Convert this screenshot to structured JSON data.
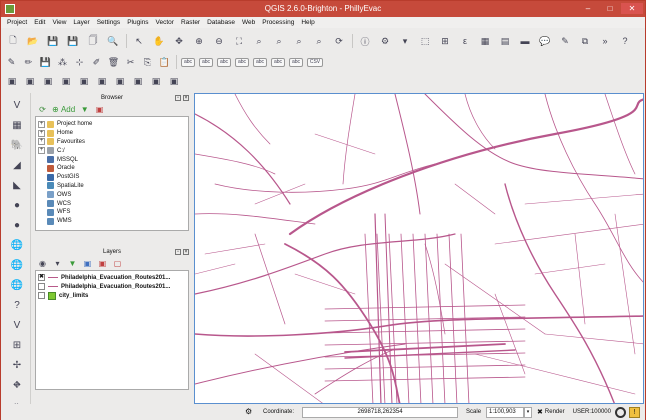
{
  "window": {
    "title": "QGIS 2.6.0-Brighton - PhillyEvac",
    "controls": {
      "minimize": "–",
      "maximize": "□",
      "close": "✕"
    }
  },
  "menu": [
    "Project",
    "Edit",
    "View",
    "Layer",
    "Settings",
    "Plugins",
    "Vector",
    "Raster",
    "Database",
    "Web",
    "Processing",
    "Help"
  ],
  "toolbars": {
    "row1": [
      {
        "name": "new-project-icon",
        "glyph": "🗋"
      },
      {
        "name": "open-project-icon",
        "glyph": "📂"
      },
      {
        "name": "save-project-icon",
        "glyph": "💾"
      },
      {
        "name": "save-as-icon",
        "glyph": "💾"
      },
      {
        "name": "new-print-composer-icon",
        "glyph": "🗍"
      },
      {
        "name": "composer-manager-icon",
        "glyph": "🔍"
      },
      {
        "name": "sep"
      },
      {
        "name": "select-pointer-icon",
        "glyph": "↖"
      },
      {
        "name": "pan-hand-icon",
        "glyph": "✋"
      },
      {
        "name": "pan-to-selection-icon",
        "glyph": "✥"
      },
      {
        "name": "zoom-in-icon",
        "glyph": "⊕"
      },
      {
        "name": "zoom-out-icon",
        "glyph": "⊖"
      },
      {
        "name": "zoom-full-icon",
        "glyph": "⛶"
      },
      {
        "name": "zoom-selection-icon",
        "glyph": "⌕"
      },
      {
        "name": "zoom-layer-icon",
        "glyph": "⌕"
      },
      {
        "name": "zoom-last-icon",
        "glyph": "⌕"
      },
      {
        "name": "zoom-next-icon",
        "glyph": "⌕"
      },
      {
        "name": "refresh-icon",
        "glyph": "⟳"
      },
      {
        "name": "sep"
      },
      {
        "name": "identify-icon",
        "glyph": "ⓘ"
      },
      {
        "name": "select-features-icon",
        "glyph": "⚙"
      },
      {
        "name": "select-dropdown-icon",
        "glyph": "▾"
      },
      {
        "name": "deselect-icon",
        "glyph": "⬚"
      },
      {
        "name": "field-calculator-icon",
        "glyph": "⊞"
      },
      {
        "name": "measure-icon",
        "glyph": "ε"
      },
      {
        "name": "attribute-table-icon",
        "glyph": "▦"
      },
      {
        "name": "statistics-icon",
        "glyph": "▤"
      },
      {
        "name": "measure-line-icon",
        "glyph": "▬"
      },
      {
        "name": "map-tips-icon",
        "glyph": "💬"
      },
      {
        "name": "new-bookmark-icon",
        "glyph": "✎"
      },
      {
        "name": "show-bookmarks-icon",
        "glyph": "⧉"
      },
      {
        "name": "text-annotation-icon",
        "glyph": "»"
      },
      {
        "name": "help-icon",
        "glyph": "?"
      }
    ],
    "row2": [
      {
        "name": "current-edits-icon",
        "glyph": "✎"
      },
      {
        "name": "toggle-editing-icon",
        "glyph": "✏"
      },
      {
        "name": "save-edits-icon",
        "glyph": "💾"
      },
      {
        "name": "add-feature-icon",
        "glyph": "⁂"
      },
      {
        "name": "move-feature-icon",
        "glyph": "⊹"
      },
      {
        "name": "node-tool-icon",
        "glyph": "✐"
      },
      {
        "name": "delete-selected-icon",
        "glyph": "🗑"
      },
      {
        "name": "cut-features-icon",
        "glyph": "✂"
      },
      {
        "name": "copy-features-icon",
        "glyph": "⎘"
      },
      {
        "name": "paste-features-icon",
        "glyph": "📋"
      },
      {
        "name": "sep"
      },
      {
        "name": "label-tool-icon",
        "glyph": "abc"
      },
      {
        "name": "highlight-pinned-icon",
        "glyph": "abc"
      },
      {
        "name": "pin-labels-icon",
        "glyph": "abc"
      },
      {
        "name": "show-hide-labels-icon",
        "glyph": "abc"
      },
      {
        "name": "move-label-icon",
        "glyph": "abc"
      },
      {
        "name": "rotate-label-icon",
        "glyph": "abc"
      },
      {
        "name": "change-label-icon",
        "glyph": "abc"
      },
      {
        "name": "csv-icon",
        "glyph": "CSV"
      }
    ],
    "row3": [
      {
        "name": "add-vector-layer-icon",
        "glyph": "▣"
      },
      {
        "name": "add-raster-layer-icon",
        "glyph": "▣"
      },
      {
        "name": "add-postgis-layer-icon",
        "glyph": "▣"
      },
      {
        "name": "add-spatialite-layer-icon",
        "glyph": "▣"
      },
      {
        "name": "add-mssql-layer-icon",
        "glyph": "▣"
      },
      {
        "name": "add-oracle-layer-icon",
        "glyph": "▣"
      },
      {
        "name": "add-wms-layer-icon",
        "glyph": "▣"
      },
      {
        "name": "add-wcs-layer-icon",
        "glyph": "▣"
      },
      {
        "name": "add-wfs-layer-icon",
        "glyph": "▣"
      },
      {
        "name": "new-shapefile-icon",
        "glyph": "▣"
      }
    ],
    "left": [
      {
        "name": "add-vector-icon",
        "glyph": "V"
      },
      {
        "name": "add-raster-icon",
        "glyph": "▦"
      },
      {
        "name": "add-postgis-icon",
        "glyph": "🐘"
      },
      {
        "name": "add-spatialite-icon",
        "glyph": "◢"
      },
      {
        "name": "add-mssql-icon",
        "glyph": "◣"
      },
      {
        "name": "add-oracle-icon",
        "glyph": "●"
      },
      {
        "name": "add-db2-icon",
        "glyph": "●"
      },
      {
        "name": "add-wms-icon",
        "glyph": "🌐"
      },
      {
        "name": "add-wcs-icon",
        "glyph": "🌐"
      },
      {
        "name": "add-wfs-icon",
        "glyph": "🌐"
      },
      {
        "name": "add-delimited-text-icon",
        "glyph": "?"
      },
      {
        "name": "add-virtual-layer-icon",
        "glyph": "V"
      },
      {
        "name": "new-layer-icon",
        "glyph": "⊞"
      },
      {
        "name": "gps-tools-icon",
        "glyph": "✢"
      },
      {
        "name": "coordinate-capture-icon",
        "glyph": "⛖"
      },
      {
        "name": "expand-toolbar-icon",
        "glyph": "»"
      }
    ]
  },
  "browser": {
    "title": "Browser",
    "add_label": "Add",
    "items": [
      {
        "label": "Project home",
        "color": "#e8c15a",
        "expandable": true
      },
      {
        "label": "Home",
        "color": "#e8c15a",
        "expandable": true
      },
      {
        "label": "Favourites",
        "color": "#e8c15a",
        "expandable": true
      },
      {
        "label": "C:/",
        "color": "#9aa0a8",
        "expandable": true
      },
      {
        "label": "MSSQL",
        "color": "#4a6fa8",
        "expandable": false
      },
      {
        "label": "Oracle",
        "color": "#c05a3a",
        "expandable": false
      },
      {
        "label": "PostGIS",
        "color": "#3a6aa8",
        "expandable": false
      },
      {
        "label": "SpatiaLite",
        "color": "#4a8ab8",
        "expandable": false
      },
      {
        "label": "OWS",
        "color": "#7aa0c8",
        "expandable": false
      },
      {
        "label": "WCS",
        "color": "#5a8ab8",
        "expandable": false
      },
      {
        "label": "WFS",
        "color": "#5a8ab8",
        "expandable": false
      },
      {
        "label": "WMS",
        "color": "#5a8ab8",
        "expandable": false
      }
    ]
  },
  "layers": {
    "title": "Layers",
    "items": [
      {
        "label": "Philadelphia_Evacuation_Routes201...",
        "checked": true,
        "symbol": "line",
        "color": "#b85a8a"
      },
      {
        "label": "Philadelphia_Evacuation_Routes201...",
        "checked": false,
        "symbol": "line",
        "color": "#b85a8a"
      },
      {
        "label": "city_limits",
        "checked": false,
        "symbol": "fill",
        "color": "#7ec832"
      }
    ]
  },
  "status": {
    "coordinate_label": "Coordinate:",
    "coordinate_value": "2698718,262354",
    "scale_label": "Scale",
    "scale_value": "1:100,903",
    "render_label": "Render",
    "render_checked": true,
    "crs": "USER:100000"
  },
  "map": {
    "background": "#ffffff",
    "road_color": "#b8578c"
  }
}
